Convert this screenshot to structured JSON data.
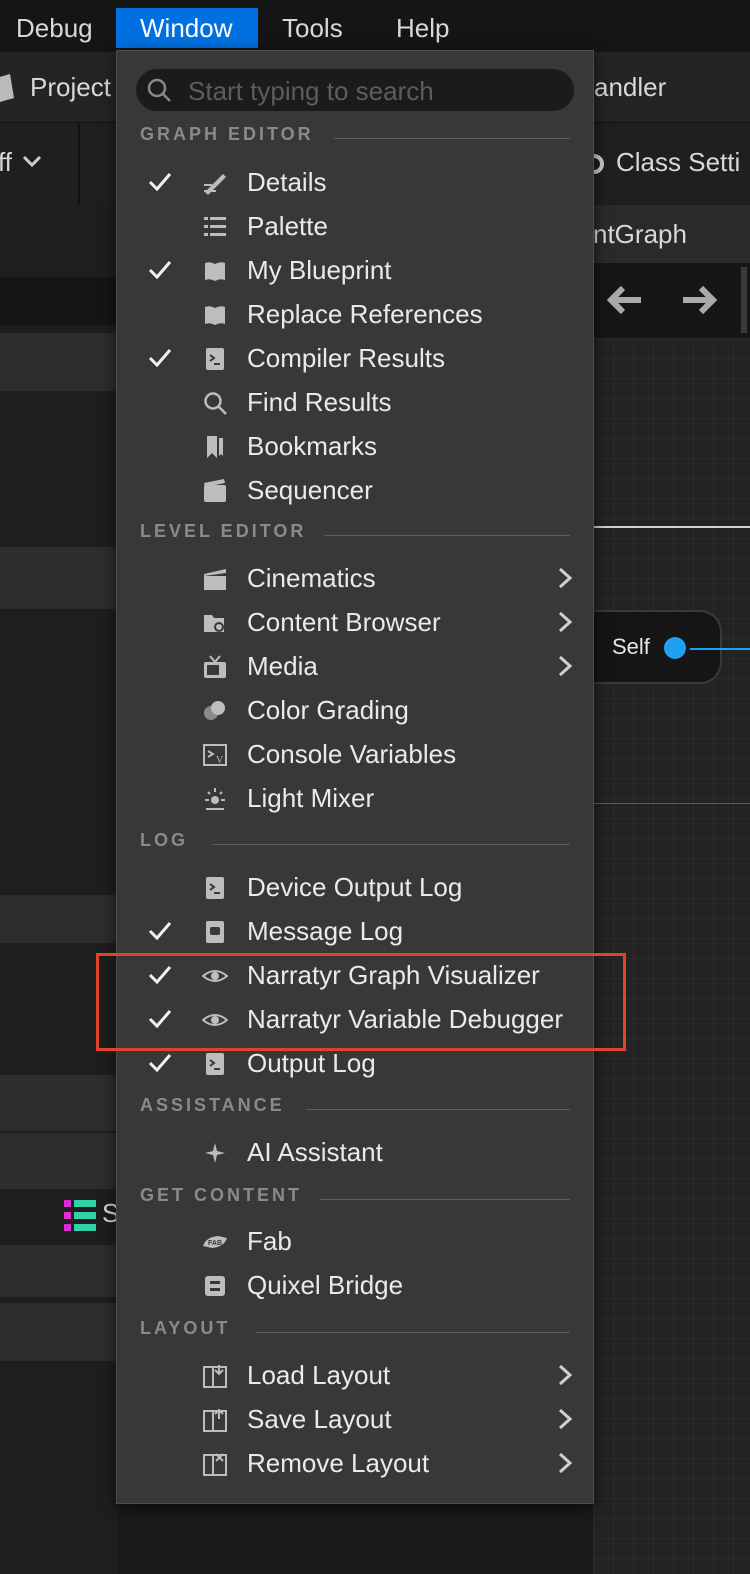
{
  "menubar": {
    "items": [
      "Debug",
      "Window",
      "Tools",
      "Help"
    ],
    "active": "Window"
  },
  "background": {
    "project_label": "Project",
    "handler_label": "andler",
    "dropdown_label": "ff",
    "class_settings_label": "Class Setti",
    "graph_tab_label": "ntGraph",
    "node_label": "Self",
    "variable_label": "S"
  },
  "menu": {
    "search_placeholder": "Start typing to search",
    "sections": [
      {
        "title": "GRAPH EDITOR",
        "items": [
          {
            "label": "Details",
            "checked": true,
            "icon": "details-icon"
          },
          {
            "label": "Palette",
            "checked": false,
            "icon": "palette-icon"
          },
          {
            "label": "My Blueprint",
            "checked": true,
            "icon": "blueprint-book-icon"
          },
          {
            "label": "Replace References",
            "checked": false,
            "icon": "blueprint-book-icon"
          },
          {
            "label": "Compiler Results",
            "checked": true,
            "icon": "log-icon"
          },
          {
            "label": "Find Results",
            "checked": false,
            "icon": "search-icon"
          },
          {
            "label": "Bookmarks",
            "checked": false,
            "icon": "bookmark-icon"
          },
          {
            "label": "Sequencer",
            "checked": false,
            "icon": "sequencer-icon"
          }
        ]
      },
      {
        "title": "LEVEL EDITOR",
        "items": [
          {
            "label": "Cinematics",
            "checked": false,
            "icon": "clapper-icon",
            "submenu": true
          },
          {
            "label": "Content Browser",
            "checked": false,
            "icon": "content-browser-icon",
            "submenu": true
          },
          {
            "label": "Media",
            "checked": false,
            "icon": "tv-icon",
            "submenu": true
          },
          {
            "label": "Color Grading",
            "checked": false,
            "icon": "color-grading-icon"
          },
          {
            "label": "Console Variables",
            "checked": false,
            "icon": "console-icon"
          },
          {
            "label": "Light Mixer",
            "checked": false,
            "icon": "light-icon"
          }
        ]
      },
      {
        "title": "LOG",
        "items": [
          {
            "label": "Device Output Log",
            "checked": false,
            "icon": "log-icon"
          },
          {
            "label": "Message Log",
            "checked": true,
            "icon": "message-log-icon"
          },
          {
            "label": "Narratyr Graph Visualizer",
            "checked": true,
            "icon": "eye-icon"
          },
          {
            "label": "Narratyr Variable Debugger",
            "checked": true,
            "icon": "eye-icon"
          },
          {
            "label": "Output Log",
            "checked": true,
            "icon": "log-icon"
          }
        ]
      },
      {
        "title": "ASSISTANCE",
        "items": [
          {
            "label": "AI Assistant",
            "checked": false,
            "icon": "sparkle-icon"
          }
        ]
      },
      {
        "title": "GET CONTENT",
        "items": [
          {
            "label": "Fab",
            "checked": false,
            "icon": "fab-icon"
          },
          {
            "label": "Quixel Bridge",
            "checked": false,
            "icon": "bridge-icon"
          }
        ]
      },
      {
        "title": "LAYOUT",
        "items": [
          {
            "label": "Load Layout",
            "checked": false,
            "icon": "load-layout-icon",
            "submenu": true
          },
          {
            "label": "Save Layout",
            "checked": false,
            "icon": "save-layout-icon",
            "submenu": true
          },
          {
            "label": "Remove Layout",
            "checked": false,
            "icon": "remove-layout-icon",
            "submenu": true
          }
        ]
      }
    ]
  },
  "colors": {
    "accent": "#0070e0",
    "highlight_box": "#e0432b",
    "pin": "#1fa0f0"
  }
}
